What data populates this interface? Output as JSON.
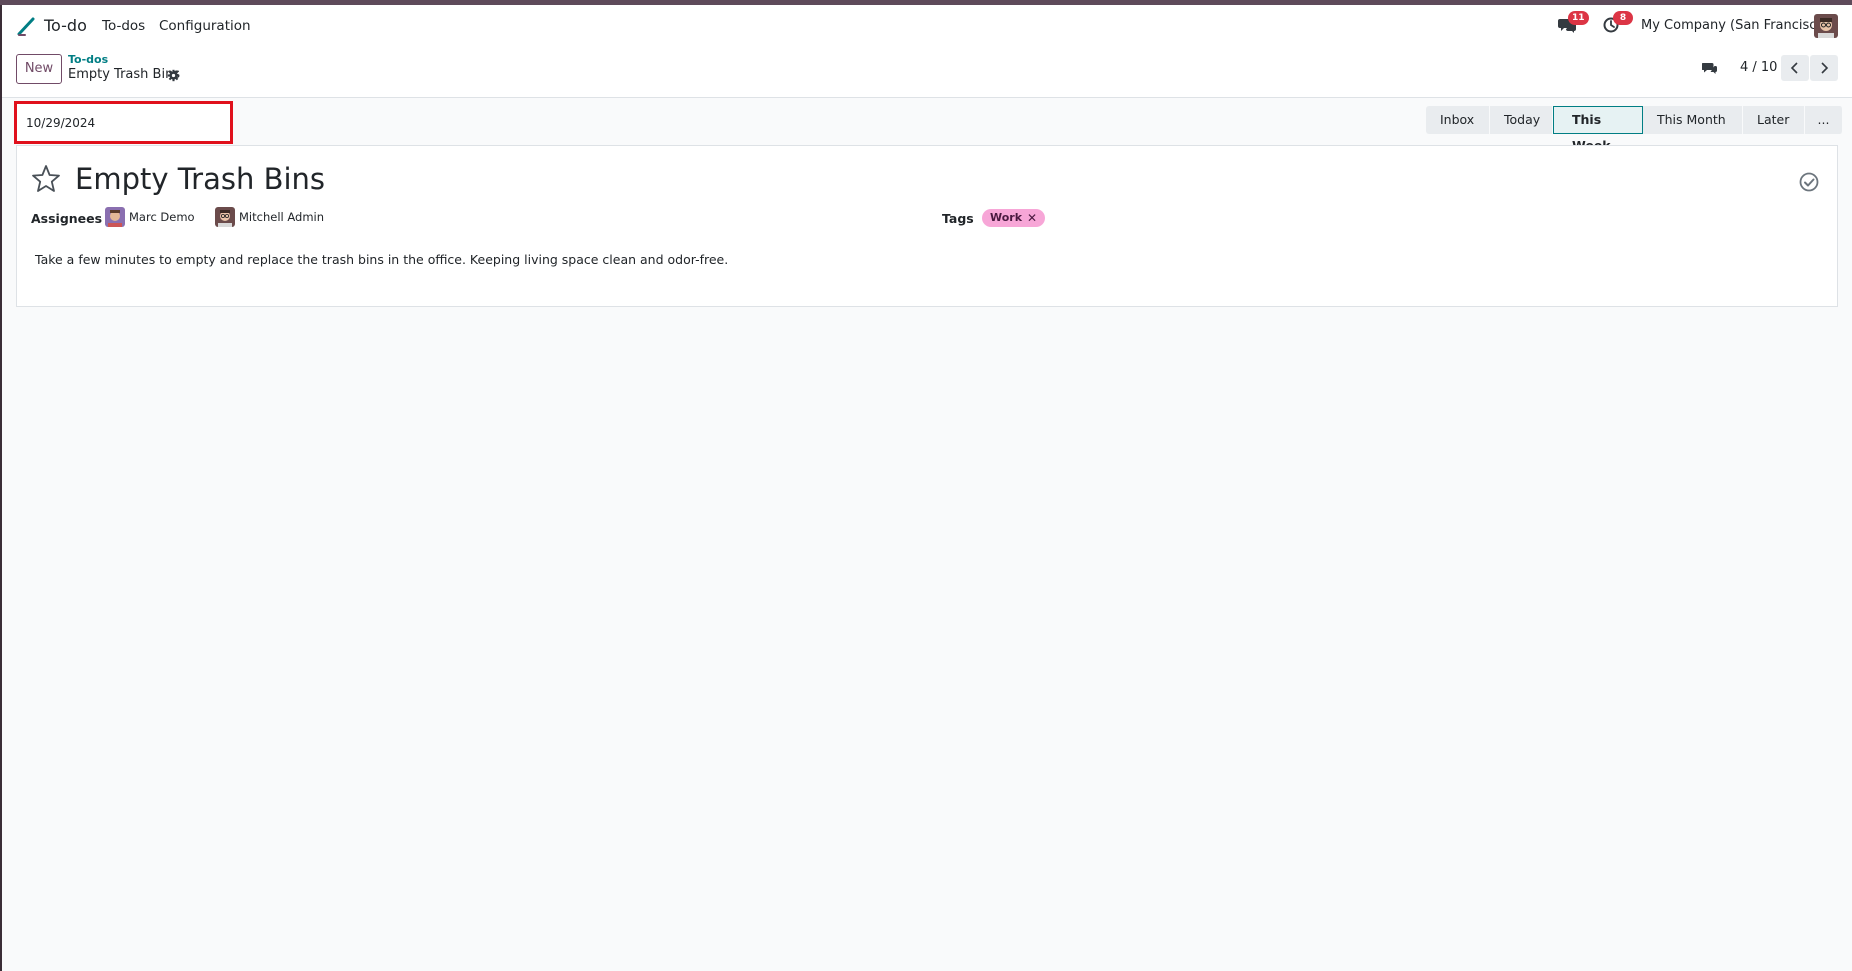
{
  "navbar": {
    "app_name": "To-do",
    "menu": [
      "To-dos",
      "Configuration"
    ],
    "messages_badge": "11",
    "activities_badge": "8",
    "company": "My Company (San Francisco)"
  },
  "control_panel": {
    "new_label": "New",
    "breadcrumb_parent": "To-dos",
    "breadcrumb_current": "Empty Trash Bins",
    "pager_value": "4 / 10"
  },
  "date_field": {
    "value": "10/29/2024"
  },
  "stages": [
    "Inbox",
    "Today",
    "This Week",
    "This Month",
    "Later",
    "..."
  ],
  "stage_active": "This Week",
  "record": {
    "title": "Empty Trash Bins",
    "assignees_label": "Assignees",
    "assignees": [
      "Marc Demo",
      "Mitchell Admin"
    ],
    "tags_label": "Tags",
    "tags": [
      "Work"
    ],
    "description": "Take a few minutes to empty and replace the trash bins in the office. Keeping living space clean and odor-free."
  },
  "colors": {
    "brand": "#714b67",
    "accent": "#017e84",
    "highlight_box": "#e0101c",
    "tag_work": "#f7a6d7",
    "badge": "#dc3545"
  }
}
